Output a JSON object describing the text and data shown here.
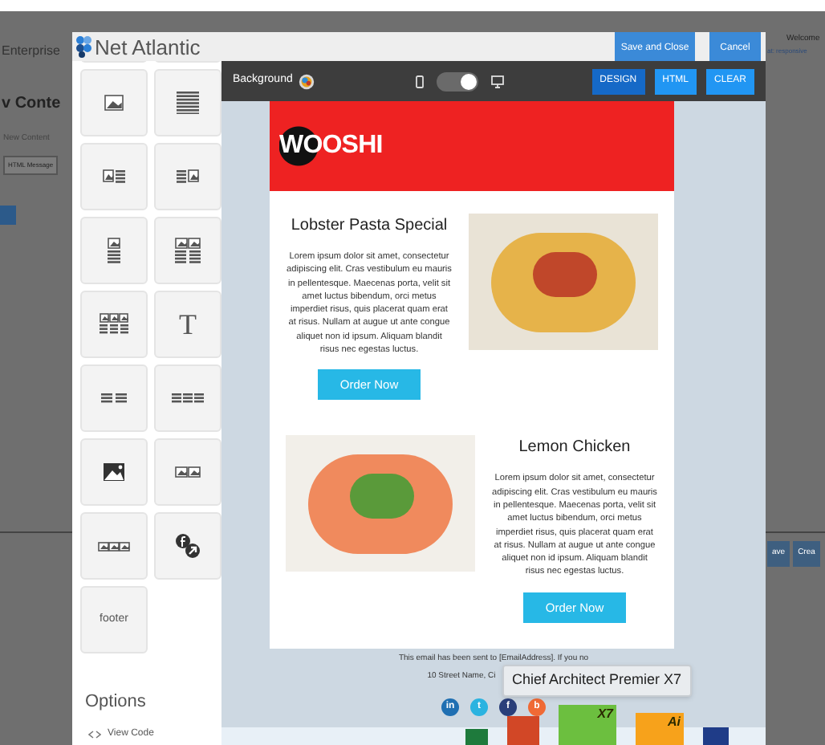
{
  "background_app": {
    "brand": "Enterprise",
    "heading": "v Conte",
    "crumb": "New Content",
    "tab": "HTML Message",
    "welcome": "Welcome",
    "account": "at: responsive",
    "buttons": [
      "ave",
      "Crea"
    ]
  },
  "modal": {
    "logo": "Net Atlantic",
    "actions": [
      "Save and Close",
      "Cancel"
    ],
    "palette": [
      {
        "kind": "image"
      },
      {
        "kind": "lines"
      },
      {
        "kind": "image-text"
      },
      {
        "kind": "text-image"
      },
      {
        "kind": "image-stack"
      },
      {
        "kind": "two-image-stack"
      },
      {
        "kind": "three-image-stack"
      },
      {
        "kind": "text",
        "label": "T"
      },
      {
        "kind": "two-lines"
      },
      {
        "kind": "three-lines"
      },
      {
        "kind": "big-image"
      },
      {
        "kind": "two-images"
      },
      {
        "kind": "three-images"
      },
      {
        "kind": "social"
      },
      {
        "kind": "footer",
        "label": "footer"
      }
    ],
    "options_title": "Options",
    "options": [
      "View Code"
    ]
  },
  "toolbar": {
    "background_label": "Background",
    "desktop_view": true,
    "modes": [
      {
        "label": "DESIGN",
        "selected": true
      },
      {
        "label": "HTML",
        "selected": false
      },
      {
        "label": "CLEAR",
        "selected": false
      }
    ]
  },
  "email": {
    "brand": "WOOSHI",
    "sections": [
      {
        "title": "Lobster Pasta Special",
        "body": "Lorem ipsum dolor sit amet, consectetur adipiscing elit. Cras vestibulum eu mauris in pellentesque. Maecenas porta, velit sit amet luctus bibendum, orci metus imperdiet risus, quis placerat quam erat at risus. Nullam at augue ut ante congue aliquet non id ipsum. Aliquam blandit risus nec egestas luctus.",
        "button": "Order Now"
      },
      {
        "title": "Lemon Chicken",
        "body": "Lorem ipsum dolor sit amet, consectetur adipiscing elit. Cras vestibulum eu mauris in pellentesque. Maecenas porta, velit sit amet luctus bibendum, orci metus imperdiet risus, quis placerat quam erat at risus. Nullam at augue ut ante congue aliquet non id ipsum. Aliquam blandit risus nec egestas luctus.",
        "button": "Order Now"
      }
    ],
    "footer_notice": "This email has been sent to [EmailAddress]. If you no",
    "footer_address": "10 Street Name, Ci",
    "social": [
      {
        "label": "in",
        "color": "#1f6fb2"
      },
      {
        "label": "t",
        "color": "#2bb3e0"
      },
      {
        "label": "f",
        "color": "#2a3f7a"
      },
      {
        "label": "b",
        "color": "#f06a35"
      }
    ]
  },
  "tooltip": "Chief Architect Premier X7",
  "dock": [
    {
      "color": "#1e7a3c"
    },
    {
      "color": "#d24726"
    },
    {
      "color": "#6cbf3f",
      "label": "X7"
    },
    {
      "color": "#f7a21b",
      "label": "Ai"
    },
    {
      "color": "#1f3c88"
    }
  ]
}
